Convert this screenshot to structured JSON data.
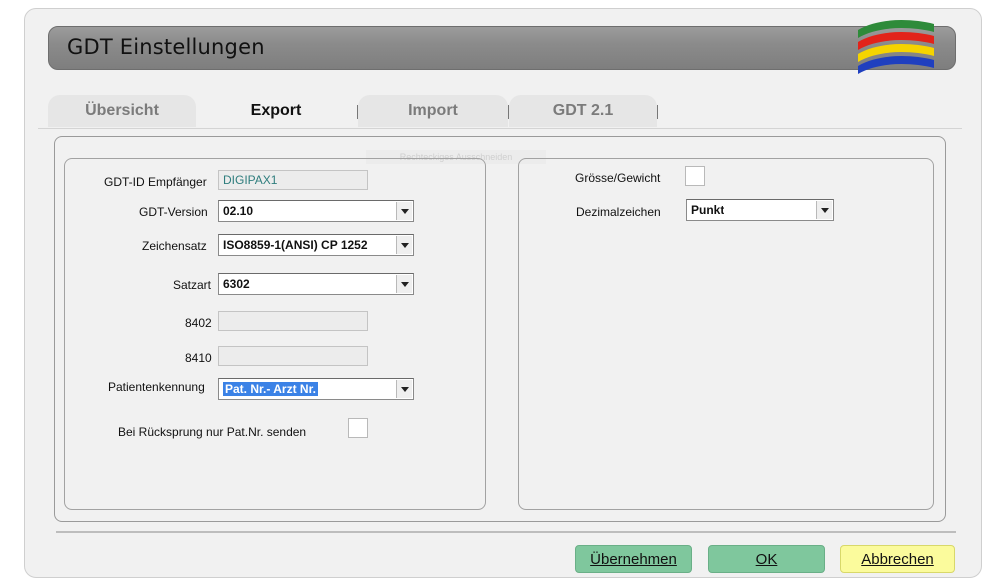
{
  "window": {
    "title": "GDT Einstellungen"
  },
  "colors": {
    "logo_green": "#2e8b3a",
    "logo_red": "#e2231a",
    "logo_yellow": "#f5d400",
    "logo_blue": "#1f3fbf",
    "selection": "#3b82e6",
    "button_green": "#7fc79d",
    "button_yellow": "#fbfb9c"
  },
  "tabs": [
    {
      "label": "Übersicht",
      "active": false
    },
    {
      "label": "Export",
      "active": true
    },
    {
      "label": "Import",
      "active": false
    },
    {
      "label": "GDT 2.1",
      "active": false
    }
  ],
  "ghost_text": "Rechteckiges Ausschneiden",
  "left": {
    "gdt_id_label": "GDT-ID Empfänger",
    "gdt_id_value": "DIGIPAX1",
    "gdt_version_label": "GDT-Version",
    "gdt_version_value": "02.10",
    "zeichensatz_label": "Zeichensatz",
    "zeichensatz_value": "ISO8859-1(ANSI) CP 1252",
    "satzart_label": "Satzart",
    "satzart_value": "6302",
    "field_8402_label": "8402",
    "field_8402_value": "",
    "field_8410_label": "8410",
    "field_8410_value": "",
    "patientenkennung_label": "Patientenkennung",
    "patientenkennung_value": "Pat. Nr.- Arzt Nr.",
    "ruecksprung_label": "Bei Rücksprung nur Pat.Nr. senden",
    "ruecksprung_checked": false
  },
  "right": {
    "groesse_label": "Grösse/Gewicht",
    "groesse_checked": false,
    "dezimal_label": "Dezimalzeichen",
    "dezimal_value": "Punkt"
  },
  "buttons": {
    "apply": "Übernehmen",
    "ok": "OK",
    "cancel": "Abbrechen"
  }
}
